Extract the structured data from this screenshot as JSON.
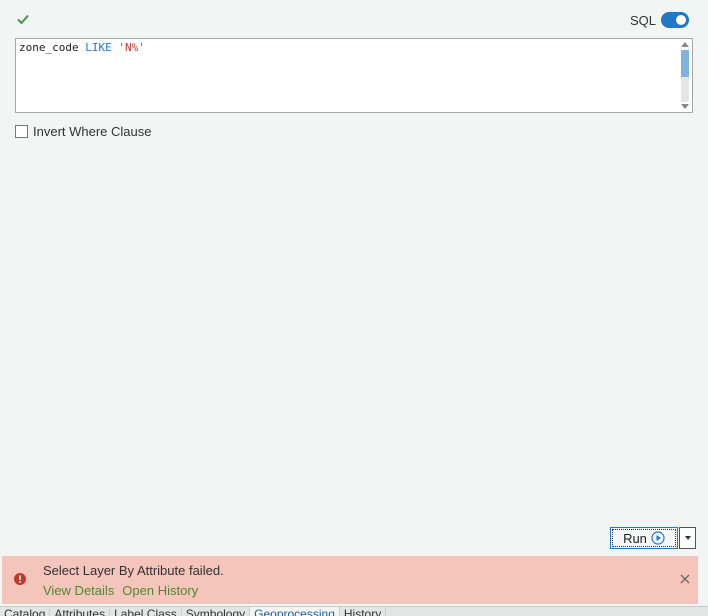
{
  "toolbar": {
    "status_icon": "check-icon",
    "sql_label": "SQL",
    "sql_toggle_on": true
  },
  "editor": {
    "field": "zone_code",
    "operator": "LIKE",
    "value": "'N%'"
  },
  "options": {
    "invert_label": "Invert Where Clause",
    "invert_checked": false
  },
  "actions": {
    "run_label": "Run"
  },
  "error": {
    "message": "Select Layer By Attribute failed.",
    "view_details": "View Details",
    "open_history": "Open History"
  },
  "tabs": [
    {
      "label": "Catalog"
    },
    {
      "label": "Attributes"
    },
    {
      "label": "Label Class"
    },
    {
      "label": "Symbology"
    },
    {
      "label": "Geoprocessing"
    },
    {
      "label": "History"
    }
  ],
  "colors": {
    "accent": "#1f78c8",
    "error_bg": "#f5c4bb",
    "error_icon": "#c0392b",
    "link": "#4e8a2f",
    "success": "#3c9a4a"
  }
}
